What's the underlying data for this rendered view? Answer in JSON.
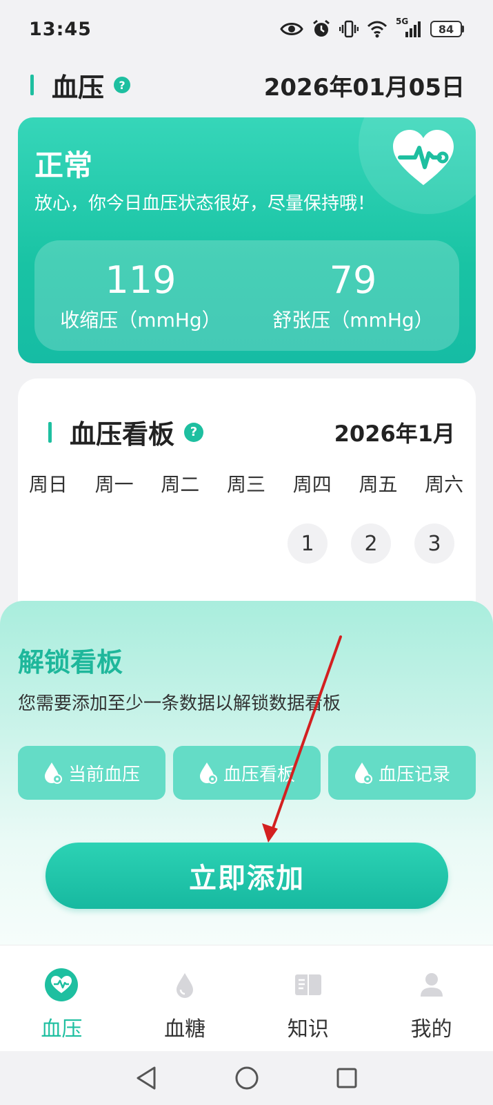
{
  "status_bar": {
    "time": "13:45",
    "network": "5G",
    "battery": "84"
  },
  "header": {
    "title": "血压",
    "help": "?",
    "date": "2026年01月05日"
  },
  "status_card": {
    "status": "正常",
    "message": "放心，你今日血压状态很好，尽量保持哦！",
    "systolic": {
      "value": "119",
      "label": "收缩压（mmHg）"
    },
    "diastolic": {
      "value": "79",
      "label": "舒张压（mmHg）"
    }
  },
  "board": {
    "title": "血压看板",
    "help": "?",
    "month": "2026年1月",
    "weekdays": [
      "周日",
      "周一",
      "周二",
      "周三",
      "周四",
      "周五",
      "周六"
    ],
    "days": [
      "1",
      "2",
      "3"
    ]
  },
  "unlock": {
    "title": "解锁看板",
    "description": "您需要添加至少一条数据以解锁数据看板",
    "chips": [
      "当前血压",
      "血压看板",
      "血压记录"
    ],
    "add_button": "立即添加"
  },
  "bottom_nav": {
    "items": [
      {
        "label": "血压",
        "icon": "heart-pulse-icon",
        "active": true
      },
      {
        "label": "血糖",
        "icon": "drop-icon",
        "active": false
      },
      {
        "label": "知识",
        "icon": "book-icon",
        "active": false
      },
      {
        "label": "我的",
        "icon": "person-icon",
        "active": false
      }
    ]
  },
  "colors": {
    "accent": "#1ebfa0",
    "card_gradient_top": "#36d6b9",
    "chip": "#64dcc6",
    "arrow": "#d32020"
  }
}
